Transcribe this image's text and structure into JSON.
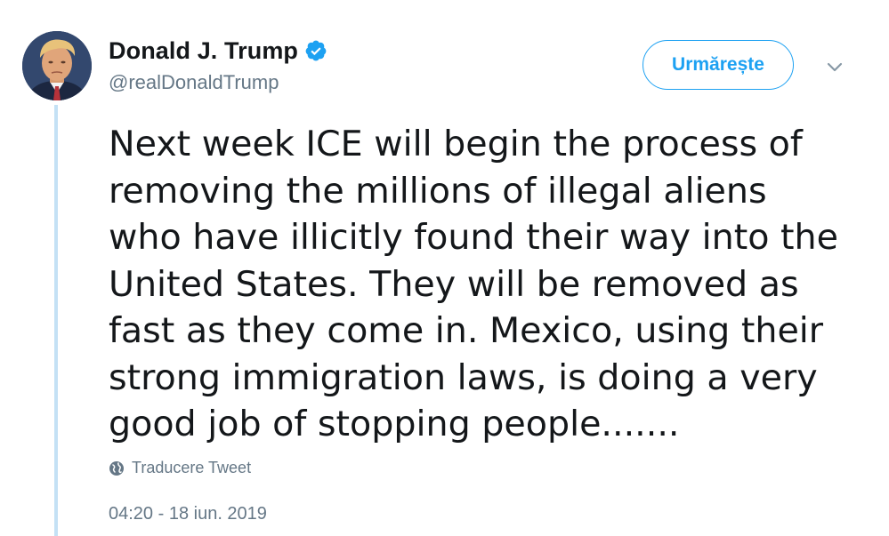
{
  "colors": {
    "accent": "#1da1f2",
    "text_primary": "#14171a",
    "text_secondary": "#657786",
    "thread_line": "#c4e1f5"
  },
  "author": {
    "display_name": "Donald J. Trump",
    "handle": "@realDonaldTrump",
    "verified": true,
    "verified_icon": "verified-badge-icon",
    "avatar_icon": "profile-photo"
  },
  "follow_button": {
    "label": "Urmărește"
  },
  "menu": {
    "icon": "chevron-down-icon"
  },
  "tweet": {
    "text": "Next week ICE will begin the process of\nremoving the millions of illegal aliens\nwho have illicitly found their way into the\nUnited States. They will be removed as\nfast as they come in. Mexico, using their\nstrong immigration laws, is doing a very\ngood job of stopping people.......",
    "translate_label": "Traducere Tweet",
    "translate_icon": "globe-icon",
    "timestamp": "04:20 - 18 iun. 2019"
  }
}
